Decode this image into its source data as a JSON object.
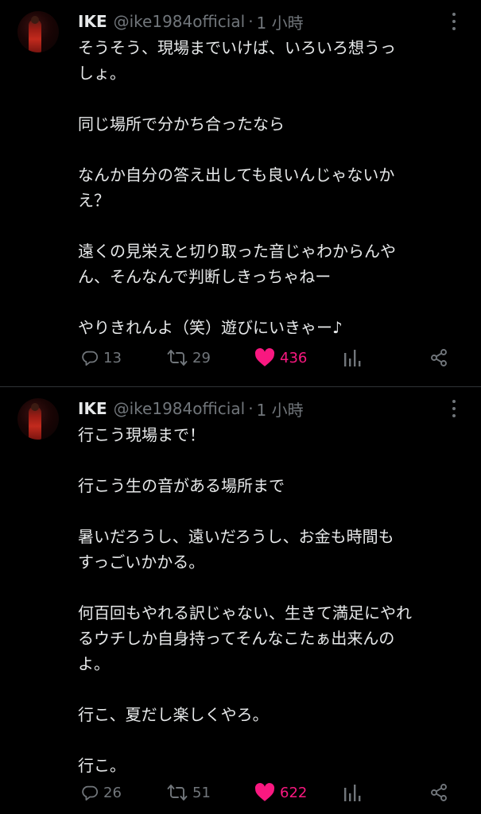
{
  "tweets": [
    {
      "author": {
        "name": "IKE",
        "handle": "@ike1984official",
        "separator": "·",
        "time": "1 小時"
      },
      "lines": [
        "そうそう、現場までいけば、いろいろ想うっ",
        "しょ。",
        "",
        "同じ場所で分かち合ったなら",
        "",
        "なんか自分の答え出しても良いんじゃないか",
        "え？",
        "",
        "遠くの見栄えと切り取った音じゃわからんや",
        "ん、そんなんで判断しきっちゃねー",
        "",
        "やりきれんよ（笑）遊びにいきゃー♪"
      ],
      "stats": {
        "replies": "13",
        "reposts": "29",
        "likes": "436"
      }
    },
    {
      "author": {
        "name": "IKE",
        "handle": "@ike1984official",
        "separator": "·",
        "time": "1 小時"
      },
      "lines": [
        "行こう現場まで！",
        "",
        "行こう生の音がある場所まで",
        "",
        "暑いだろうし、遠いだろうし、お金も時間も",
        "すっごいかかる。",
        "",
        "何百回もやれる訳じゃない、生きて満足にやれ",
        "るウチしか自身持ってそんなこたぁ出来んの",
        "よ。",
        "",
        "行こ、夏だし楽しくやろ。",
        "",
        "行こ。"
      ],
      "stats": {
        "replies": "26",
        "reposts": "51",
        "likes": "622"
      }
    }
  ],
  "colors": {
    "background": "#000000",
    "text": "#e7e9ea",
    "muted": "#71767b",
    "like": "#f91880",
    "divider": "#2f3336"
  },
  "icons": [
    "reply-icon",
    "repost-icon",
    "like-heart-icon",
    "views-icon",
    "share-icon",
    "more-options-icon"
  ]
}
